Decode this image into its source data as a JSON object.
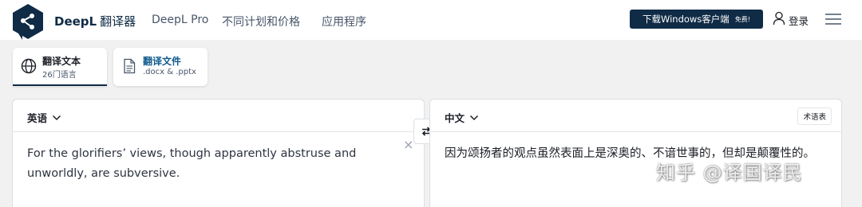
{
  "header": {
    "brand_name": "DeepL",
    "brand_product": "翻译器",
    "nav": [
      "DeepL Pro",
      "不同计划和价格",
      "应用程序"
    ],
    "download_label": "下载Windows客户端",
    "download_badge": "免费!",
    "login_label": "登录"
  },
  "modes": [
    {
      "title": "翻译文本",
      "subtitle": "26门语言"
    },
    {
      "title": "翻译文件",
      "subtitle": ".docx & .pptx"
    }
  ],
  "source": {
    "language": "英语",
    "text": "For the glorifiers’ views, though apparently abstruse and unworldly, are subversive."
  },
  "target": {
    "language": "中文",
    "glossary_label": "术语表",
    "text": "因为颂扬者的观点虽然表面上是深奥的、不谙世事的，但却是颠覆性的。"
  },
  "watermark": "知乎 @译国译民",
  "colors": {
    "brand_navy": "#0f2b46",
    "background": "#f1f1f1"
  }
}
